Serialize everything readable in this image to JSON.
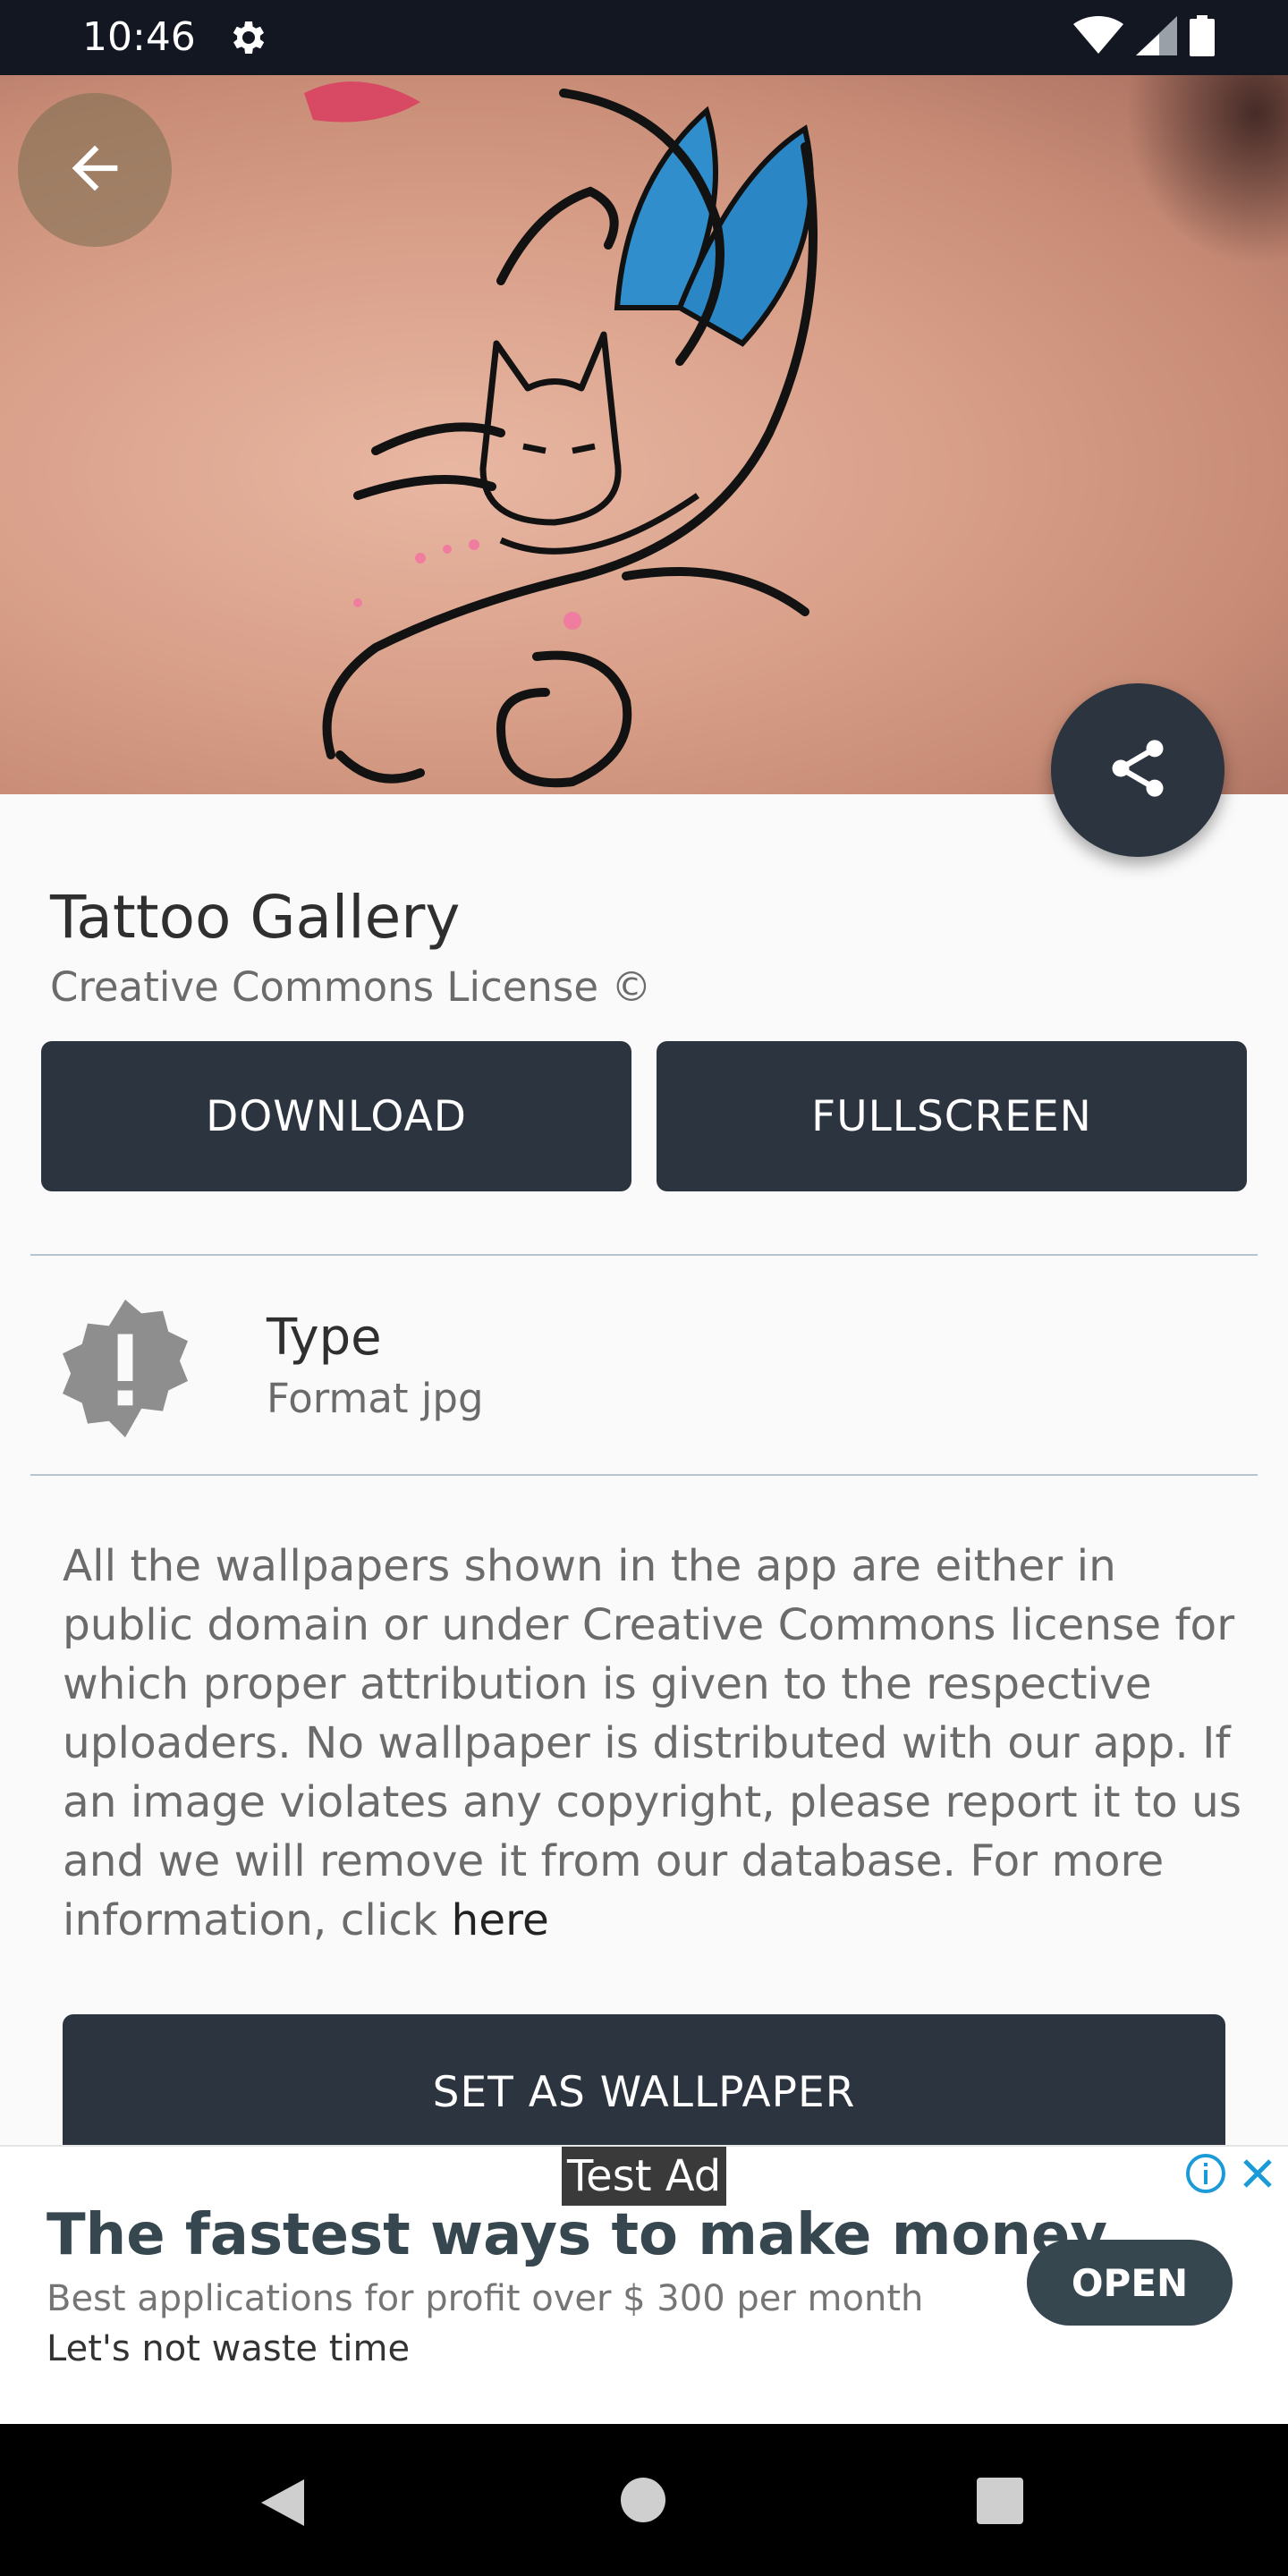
{
  "status_bar": {
    "time": "10:46",
    "icons": [
      "gear-icon",
      "wifi-icon",
      "signal-icon",
      "battery-icon"
    ]
  },
  "hero": {
    "image": "tattoo-photo-cat-and-swirls",
    "back_icon": "arrow-left-icon",
    "share_icon": "share-icon"
  },
  "wallpaper": {
    "title": "Tattoo Gallery",
    "license": "Creative Commons License ©"
  },
  "actions": {
    "download_label": "DOWNLOAD",
    "fullscreen_label": "FULLSCREEN"
  },
  "info": {
    "icon": "alert-badge-icon",
    "label": "Type",
    "value": "Format jpg"
  },
  "disclaimer": {
    "text": "All the wallpapers shown in the app are either in public domain or under Creative Commons license for which proper attribution is given to the respective uploaders. No wallpaper is distributed with our app. If an image violates any copyright, please report it to us and we will remove it from our database. For more information, click",
    "link_text": "here"
  },
  "set_wallpaper_label": "SET AS WALLPAPER",
  "ad": {
    "badge": "Test Ad",
    "headline": "The fastest ways to make money",
    "body": "Best applications for profit over $ 300 per month",
    "body_tail": "Let's not waste time",
    "cta": "OPEN"
  },
  "colors": {
    "primary_dark": "#2c3440",
    "status_bar": "#121722",
    "divider": "#b7c4cd"
  }
}
